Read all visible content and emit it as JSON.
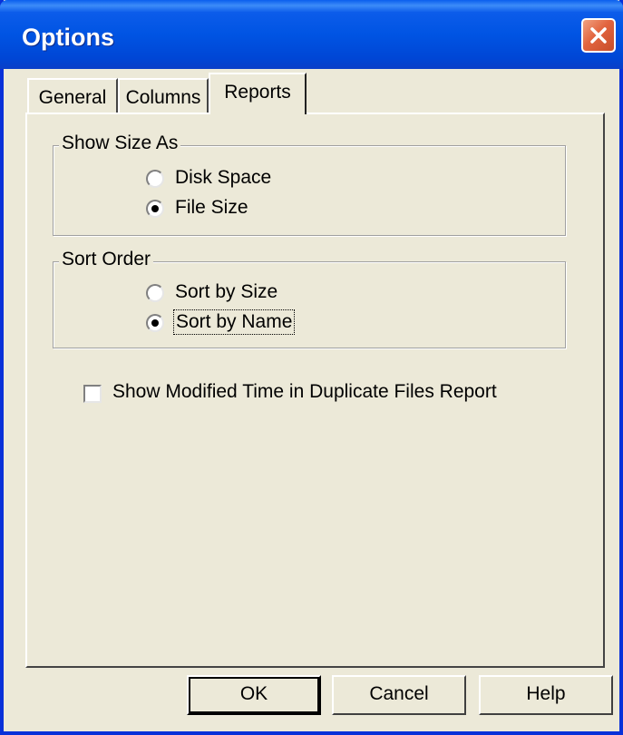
{
  "window": {
    "title": "Options"
  },
  "tabs": [
    {
      "label": "General"
    },
    {
      "label": "Columns"
    },
    {
      "label": "Reports"
    }
  ],
  "show_size_as": {
    "legend": "Show Size As",
    "options": [
      {
        "label": "Disk Space",
        "selected": false
      },
      {
        "label": "File Size",
        "selected": true
      }
    ]
  },
  "sort_order": {
    "legend": "Sort Order",
    "options": [
      {
        "label": "Sort by Size",
        "selected": false
      },
      {
        "label": "Sort by Name",
        "selected": true
      }
    ]
  },
  "options": {
    "show_modified_time": {
      "label": "Show Modified Time in Duplicate Files Report",
      "checked": false
    }
  },
  "buttons": {
    "ok": "OK",
    "cancel": "Cancel",
    "help": "Help"
  },
  "icons": {
    "close": "close-icon"
  },
  "colors": {
    "titlebar": "#0054e3",
    "close_button": "#e2643f",
    "face": "#ece9d8"
  }
}
